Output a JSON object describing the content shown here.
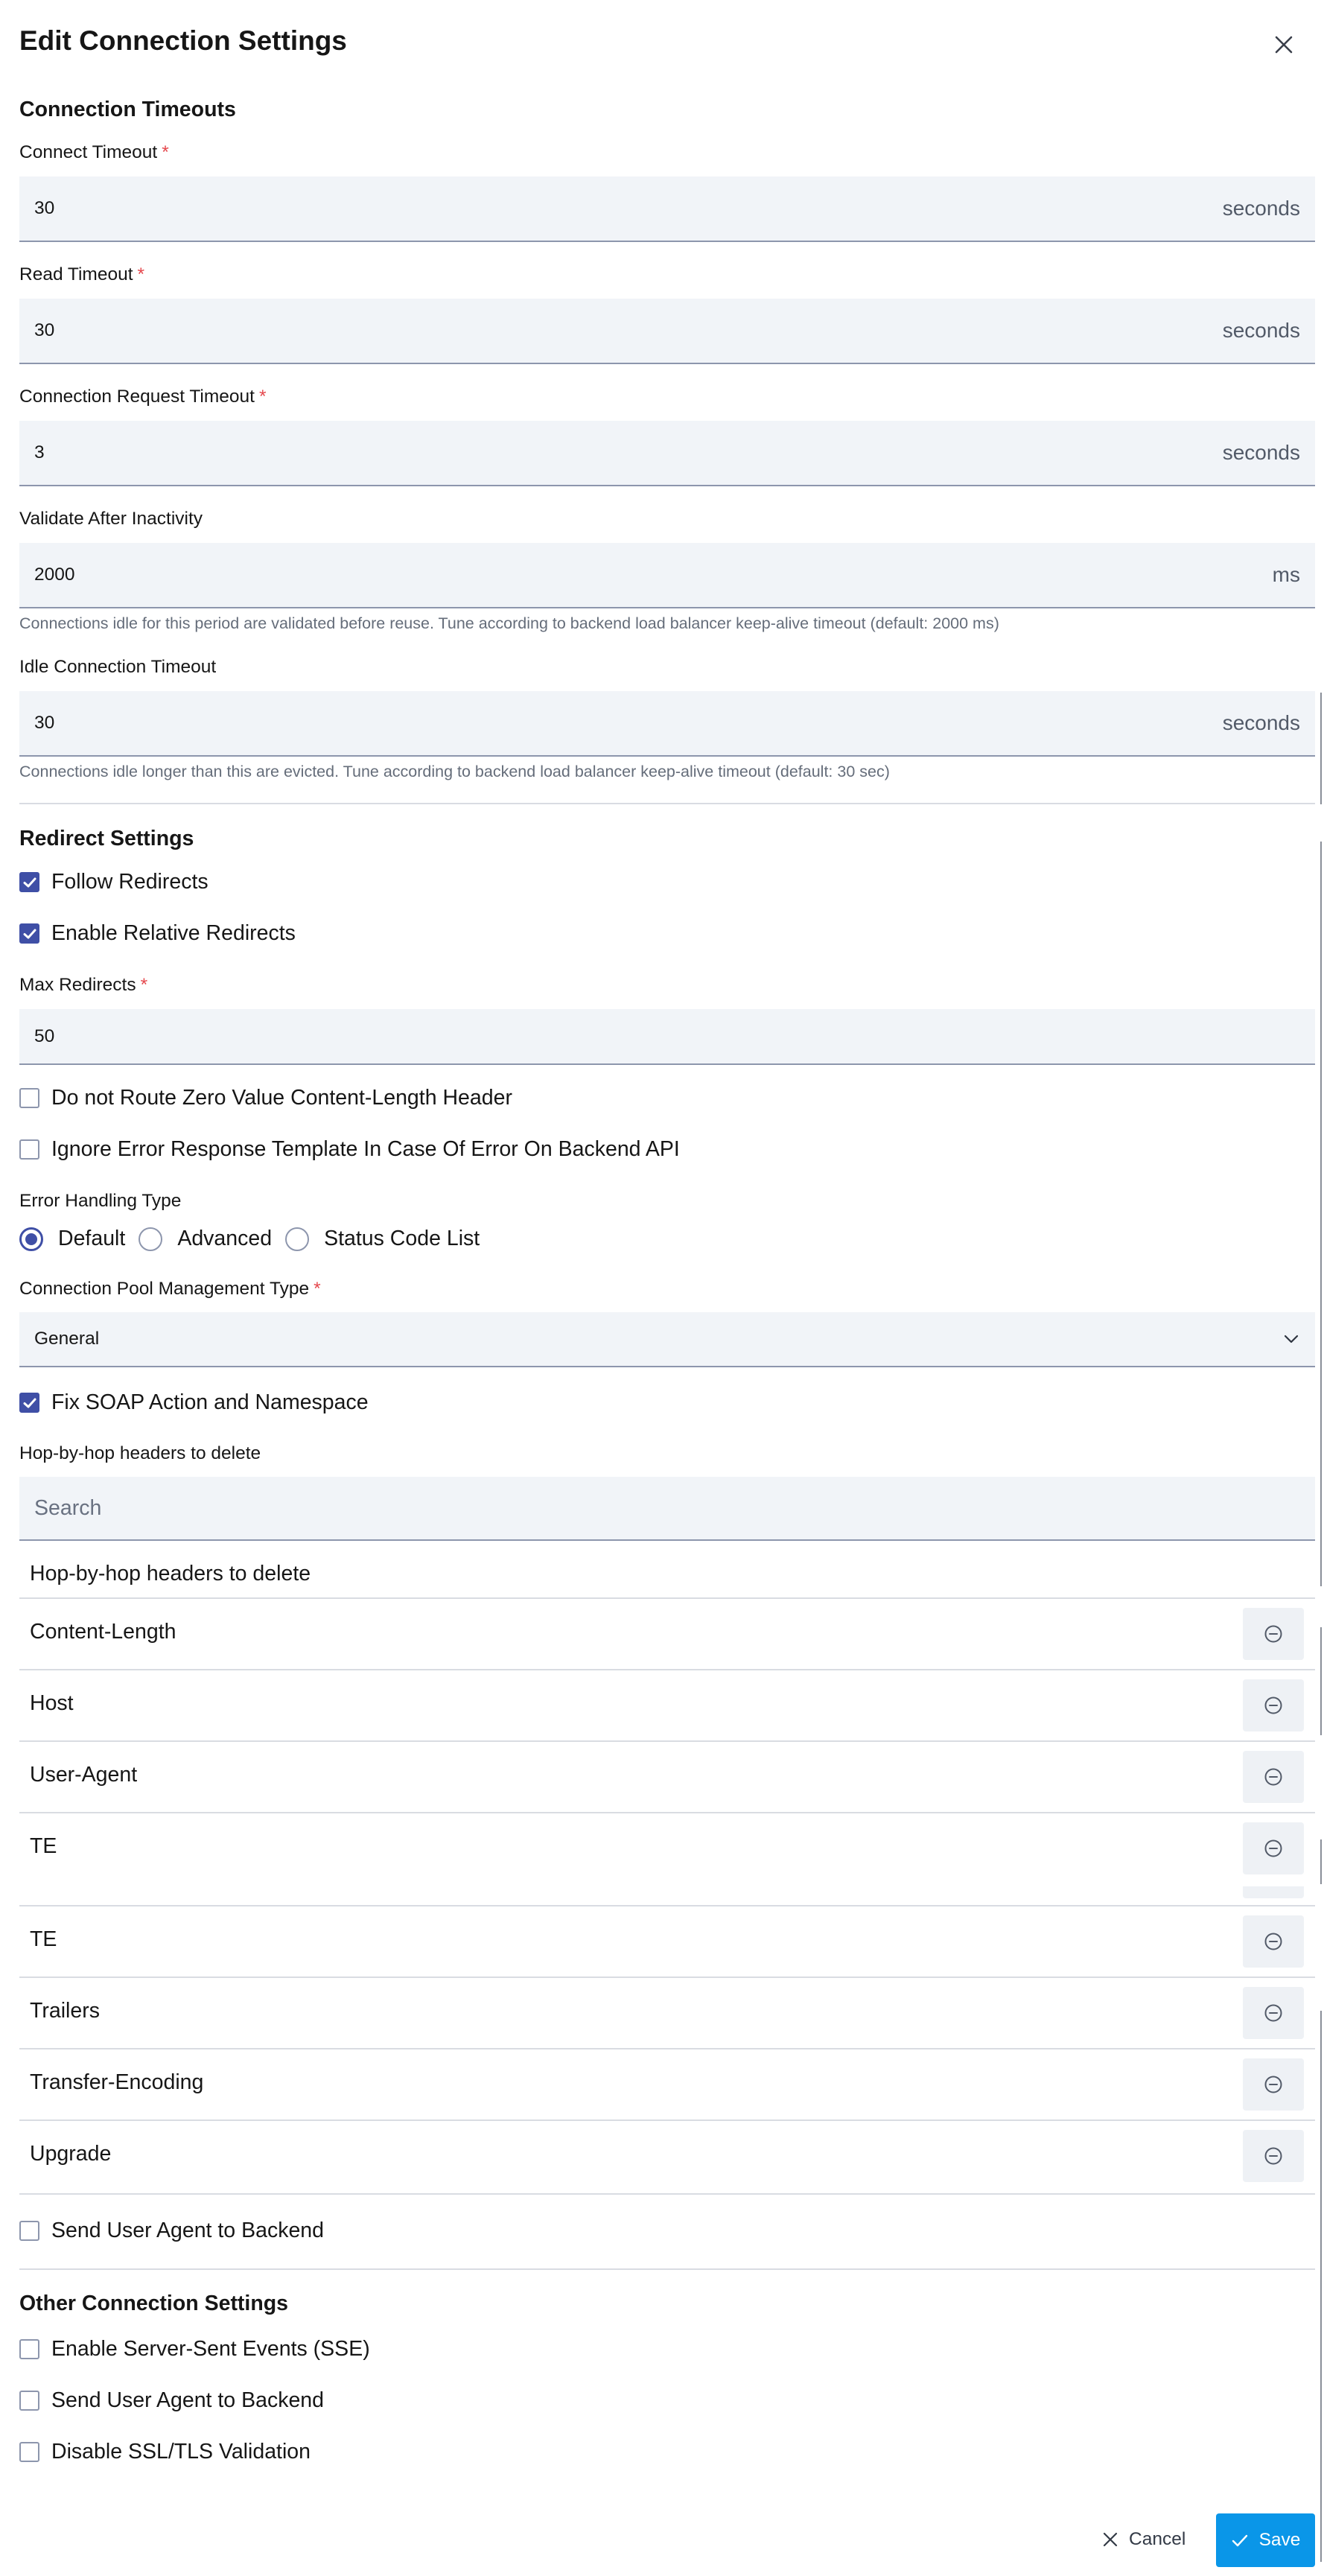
{
  "dialog": {
    "title": "Edit Connection Settings",
    "close_icon": "close-icon"
  },
  "timeouts": {
    "section_title": "Connection Timeouts",
    "connect_timeout": {
      "label": "Connect Timeout",
      "required": "*",
      "value": "30",
      "unit": "seconds"
    },
    "read_timeout": {
      "label": "Read Timeout",
      "required": "*",
      "value": "30",
      "unit": "seconds"
    },
    "request_timeout": {
      "label": "Connection Request Timeout",
      "required": "*",
      "value": "3",
      "unit": "seconds"
    },
    "validate_after_inactivity": {
      "label": "Validate After Inactivity",
      "value": "2000",
      "unit": "ms",
      "helper": "Connections idle for this period are validated before reuse. Tune according to backend load balancer keep-alive timeout (default: 2000 ms)"
    },
    "idle_timeout": {
      "label": "Idle Connection Timeout",
      "value": "30",
      "unit": "seconds",
      "helper": "Connections idle longer than this are evicted. Tune according to backend load balancer keep-alive timeout (default: 30 sec)"
    }
  },
  "redirects": {
    "section_title": "Redirect Settings",
    "follow_redirects": {
      "label": "Follow Redirects",
      "checked": true
    },
    "relative_redirects": {
      "label": "Enable Relative Redirects",
      "checked": true
    },
    "max_redirects": {
      "label": "Max Redirects",
      "required": "*",
      "value": "50"
    },
    "zero_content_length": {
      "label": "Do not Route Zero Value Content-Length Header",
      "checked": false
    },
    "ignore_error_template": {
      "label": "Ignore Error Response Template In Case Of Error On Backend API",
      "checked": false
    },
    "error_handling": {
      "label": "Error Handling Type",
      "options": [
        "Default",
        "Advanced",
        "Status Code List"
      ],
      "selected": "Default"
    },
    "pool_type": {
      "label": "Connection Pool Management Type",
      "required": "*",
      "value": "General"
    },
    "fix_soap": {
      "label": "Fix SOAP Action and Namespace",
      "checked": true
    },
    "hop_headers": {
      "label": "Hop-by-hop headers to delete",
      "search_placeholder": "Search",
      "list_title": "Hop-by-hop headers to delete",
      "items": [
        "Content-Length",
        "Host",
        "User-Agent",
        "TE",
        "TE",
        "Trailers",
        "Transfer-Encoding",
        "Upgrade"
      ]
    },
    "send_user_agent": {
      "label": "Send User Agent to Backend",
      "checked": false
    }
  },
  "other": {
    "section_title": "Other Connection Settings",
    "sse": {
      "label": "Enable Server-Sent Events (SSE)",
      "checked": false
    },
    "send_user_agent": {
      "label": "Send User Agent to Backend",
      "checked": false
    },
    "disable_ssl": {
      "label": "Disable SSL/TLS Validation",
      "checked": false
    }
  },
  "footer": {
    "cancel_label": "Cancel",
    "save_label": "Save"
  },
  "colors": {
    "accent": "#3f4fa6",
    "primary_button": "#0a96e8",
    "required": "#e5484d",
    "field_background": "#f1f4f8"
  }
}
